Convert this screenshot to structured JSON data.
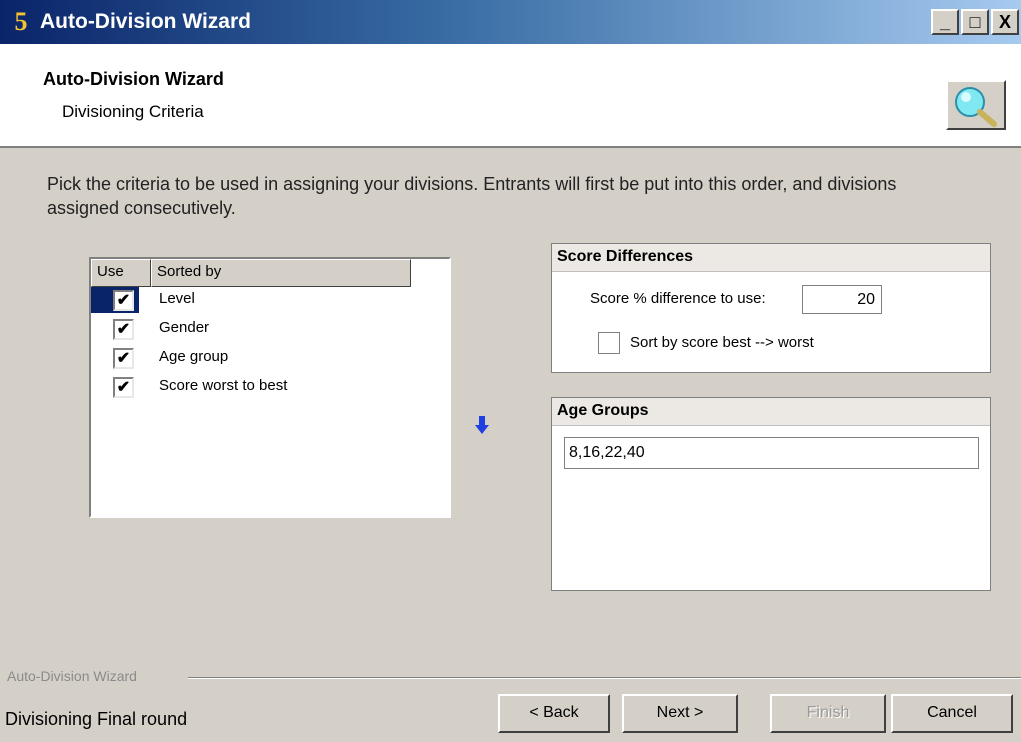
{
  "window": {
    "title": "Auto-Division Wizard",
    "app_icon_glyph": "5",
    "controls": {
      "minimize": "_",
      "maximize": "□",
      "close": "X"
    }
  },
  "header": {
    "title": "Auto-Division Wizard",
    "subtitle": "Divisioning Criteria",
    "icon": "magnifier-icon"
  },
  "instructions": "Pick the criteria to be used in assigning your divisions. Entrants will first be put into this order, and divisions assigned consecutively.",
  "criteria_list": {
    "columns": [
      "Use",
      "Sorted by"
    ],
    "rows": [
      {
        "checked": true,
        "label": "Level",
        "selected": true
      },
      {
        "checked": true,
        "label": "Gender",
        "selected": false
      },
      {
        "checked": true,
        "label": "Age group",
        "selected": false
      },
      {
        "checked": true,
        "label": "Score worst to best",
        "selected": false
      }
    ]
  },
  "arrow_icon": "arrow-down-icon",
  "score_differences": {
    "title": "Score Differences",
    "percent_label": "Score % difference to use:",
    "percent_value": "20",
    "sort_label": "Sort by score best --> worst",
    "sort_checked": false
  },
  "age_groups": {
    "title": "Age Groups",
    "value": "8,16,22,40"
  },
  "footer": {
    "group_label": "Auto-Division Wizard",
    "status": "Divisioning Final round",
    "buttons": {
      "back": "< Back",
      "next": "Next >",
      "finish": "Finish",
      "cancel": "Cancel"
    }
  },
  "colors": {
    "titlebar_start": "#0a246a",
    "titlebar_end": "#a6caf0",
    "selection": "#0a246a",
    "arrow": "#1f3fe0",
    "dialog_bg": "#d4d0c8"
  }
}
